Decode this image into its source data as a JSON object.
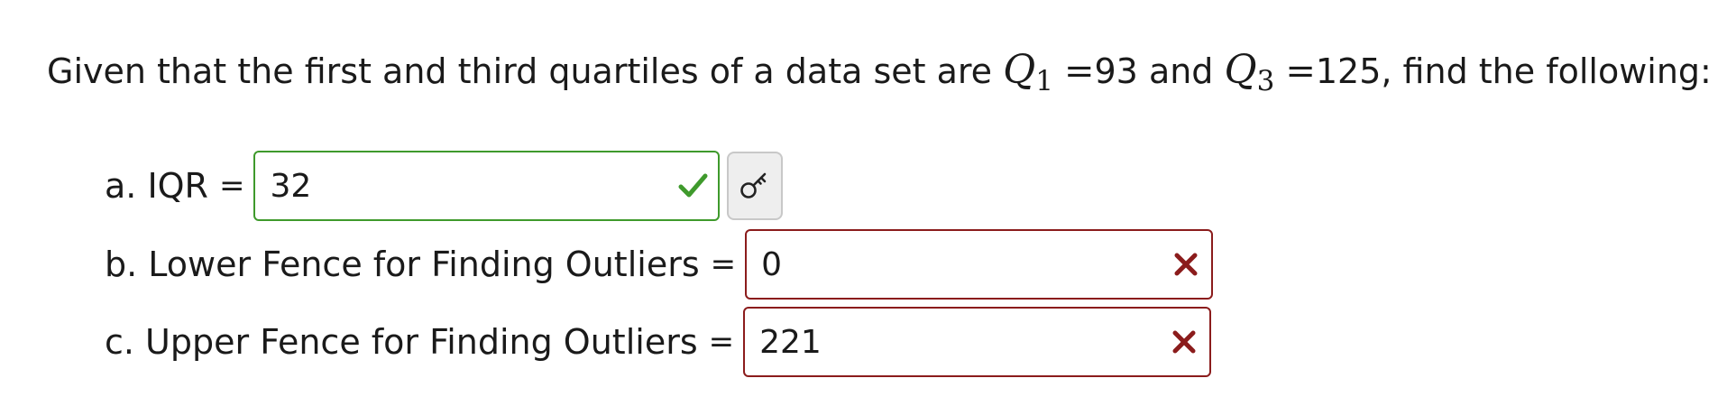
{
  "question": {
    "prefix": "Given that the first and third quartiles of a data set are",
    "q1_symbol": "Q",
    "q1_subscript": "1",
    "q1_equals": "=",
    "q1_value": "93",
    "connector": "and",
    "q3_symbol": "Q",
    "q3_subscript": "3",
    "q3_equals": "=",
    "q3_value": "125",
    "suffix": ", find the following:"
  },
  "parts": [
    {
      "label": "a. IQR",
      "equals": "=",
      "value": "32",
      "status": "correct",
      "status_color": "#3f9a2c",
      "status_icon": "checkmark-icon",
      "has_key_button": true,
      "key_icon": "key-icon"
    },
    {
      "label": "b. Lower Fence for Finding Outliers",
      "equals": "=",
      "value": "0",
      "status": "incorrect",
      "status_color": "#8b1c1c",
      "status_icon": "x-mark-icon"
    },
    {
      "label": "c. Upper Fence for Finding Outliers",
      "equals": "=",
      "value": "221",
      "status": "incorrect",
      "status_color": "#8b1c1c",
      "status_icon": "x-mark-icon"
    }
  ]
}
